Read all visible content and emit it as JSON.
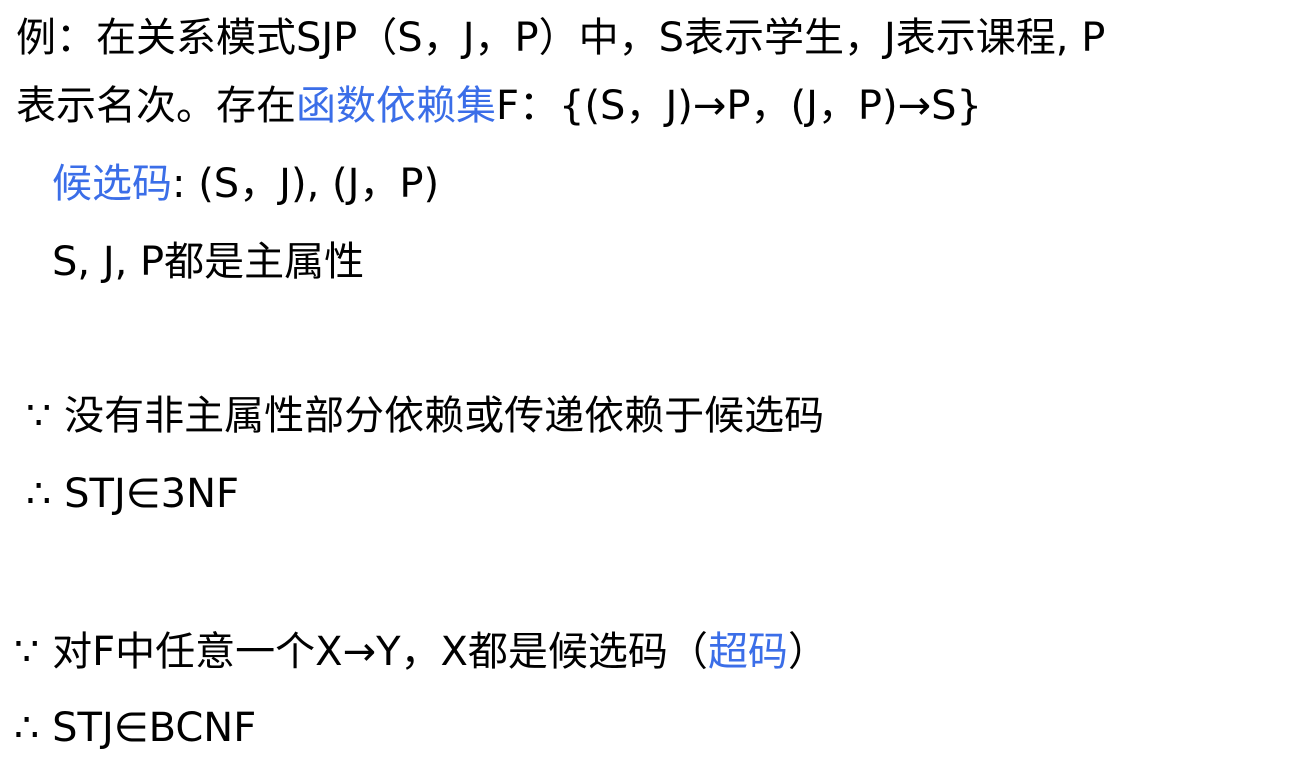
{
  "lines": {
    "l1": "例：在关系模式SJP（S，J，P）中，S表示学生，J表示课程, P",
    "l2_pre": "表示名次。存在",
    "l2_link": "函数依赖集",
    "l2_post": "F：{(S，J)→P，(J，P)→S}",
    "l3_link": "候选码",
    "l3_post": ": (S，J), (J，P)",
    "l4": "S, J, P都是主属性",
    "l5": "∵ 没有非主属性部分依赖或传递依赖于候选码",
    "l6": "∴ STJ∈3NF",
    "l7_pre": "∵ 对F中任意一个X→Y，X都是候选码（",
    "l7_link": "超码",
    "l7_post": "）",
    "l8": "∴ STJ∈BCNF"
  },
  "colors": {
    "link": "#3b6ee8",
    "text": "#000000"
  }
}
